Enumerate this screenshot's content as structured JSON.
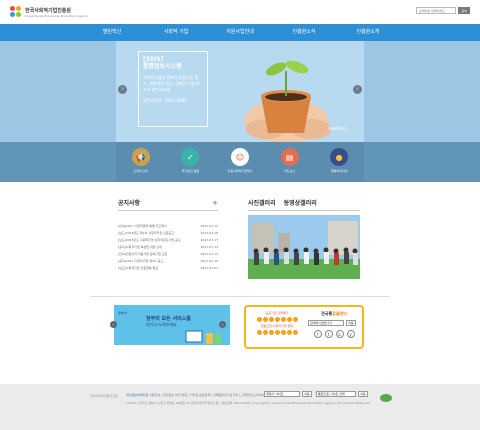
{
  "header": {
    "logo_title": "한국사회적기업진흥원",
    "logo_sub": "Korea Social Enterprise Promotion Agency",
    "search_placeholder": "검색어를 입력하세요",
    "search_button": "검색"
  },
  "nav": {
    "items": [
      "열린혁신",
      "사회적 기업",
      "지원사업안내",
      "진흥원소식",
      "진흥원소개"
    ]
  },
  "hero": {
    "title_1": "[SEIS]",
    "title_2": "통합정보시스템",
    "desc": "사회적기업의 원하던 인증신청 접수, 제정지원 업무, 공최된 사업 보고서 관리시스템",
    "phone": "※문의전화 : 1661-4096",
    "more": "자세히보기",
    "prev": "‹",
    "next": "›"
  },
  "quick": {
    "items": [
      {
        "label": "고객의 소리",
        "color": "#c9a24a",
        "icon": "megaphone-icon"
      },
      {
        "label": "국가공인 검증",
        "color": "#3bb2a9",
        "icon": "certificate-icon"
      },
      {
        "label": "인증사회적기업찾기",
        "color": "#ffffff",
        "icon": "search-people-icon"
      },
      {
        "label": "카드뉴스",
        "color": "#e0704f",
        "icon": "card-news-icon"
      },
      {
        "label": "행복아이디어",
        "color": "#3a4d8a",
        "icon": "idea-icon"
      }
    ]
  },
  "notice": {
    "title": "공지사항",
    "more": "+",
    "rows": [
      {
        "title": "[안내]2017 사회적경제 특별 주간행사",
        "date": "2017-07-19"
      },
      {
        "title": "[보도]2018년도 제1차 사회적기업 인증공고",
        "date": "2017-07-18"
      },
      {
        "title": "[보도]2018년도 사회적기업 일자리창출사업 공고",
        "date": "2017-07-17"
      },
      {
        "title": "[공지]사회적기업 육성법 개정 안내",
        "date": "2017-07-14"
      },
      {
        "title": "[안내]전문인력 지원사업 참여기업 모집",
        "date": "2017-07-12"
      },
      {
        "title": "[공지]2017 사회적기업 제2차 공고",
        "date": "2017-07-10"
      },
      {
        "title": "[보도]사회적기업 인증현황 발표",
        "date": "2017-07-07"
      }
    ]
  },
  "gallery": {
    "tab_photo": "사진갤러리",
    "tab_video": "동영상갤러리"
  },
  "banner_left": {
    "logo": "정부24",
    "line1": "정부의 모든 서비스를",
    "line2": "여기서 누려보세요",
    "prev": "‹",
    "next": "›"
  },
  "banner_right": {
    "left_line1": "공공기관 자율평가",
    "left_line2": "협동조합/사회적기업 참여",
    "title_pre": "전국통",
    "title_hl": "합콜센터",
    "select": "검색하시겠습니다",
    "go": "이동",
    "sns": [
      "f",
      "t",
      "b",
      "y"
    ]
  },
  "footer": {
    "logo": "한국사회적기업진흥원",
    "links_hl": "개인정보처리방침",
    "links": "이용안내 | 개인정보 처리 방침 | 저작권 보호정책 | 이메일무단수집거부 | 고객헌장/고객서비스 | 사이트맵",
    "address": "(13487) 경기도 성남시 수정구 창업로 40번길 32 한국사회적기업진흥원 | 대표전화 1661-4096 | Copyright(c) Korea Social Enterprise Promotion Agency. All Contents Reserved.",
    "select1": "계열사 사이트",
    "select2": "통합인증 사이트 선택",
    "go": "이동"
  }
}
